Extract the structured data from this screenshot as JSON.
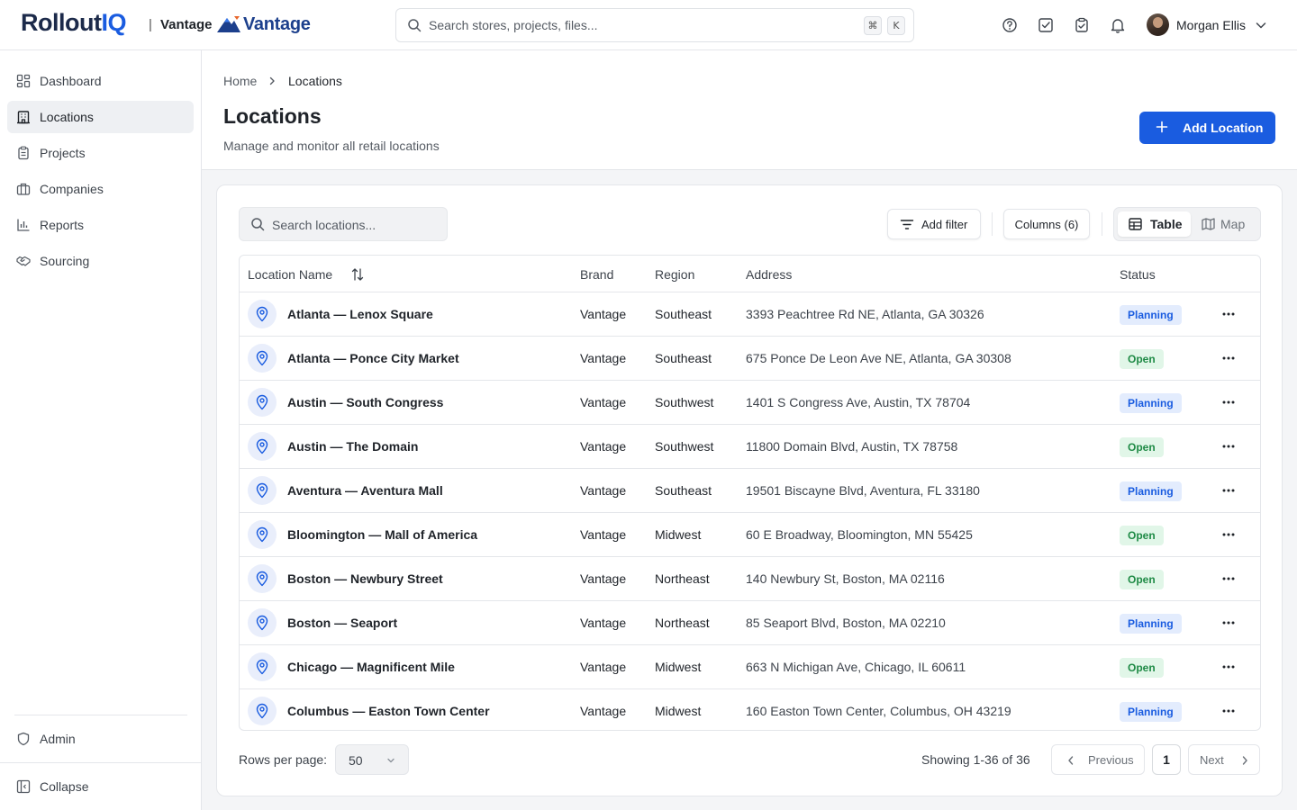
{
  "app": {
    "logo_main": "Rollout",
    "logo_accent": "IQ",
    "separator": "|",
    "tenant": "Vantage",
    "brand_logo_text": "Vantage",
    "accent_color": "#1a5ce0"
  },
  "global_search": {
    "placeholder": "Search stores, projects, files...",
    "shortcut_mod": "⌘",
    "shortcut_key": "K"
  },
  "header_icons": [
    "help-icon",
    "task-check-icon",
    "clipboard-check-icon",
    "bell-icon"
  ],
  "user": {
    "name": "Morgan Ellis"
  },
  "sidebar": {
    "items": [
      {
        "label": "Dashboard",
        "icon": "dashboard-icon"
      },
      {
        "label": "Locations",
        "icon": "building-icon",
        "active": true
      },
      {
        "label": "Projects",
        "icon": "clipboard-icon"
      },
      {
        "label": "Companies",
        "icon": "briefcase-icon"
      },
      {
        "label": "Reports",
        "icon": "bar-chart-icon"
      },
      {
        "label": "Sourcing",
        "icon": "handshake-icon"
      }
    ],
    "admin_label": "Admin",
    "collapse_label": "Collapse"
  },
  "breadcrumb": {
    "home": "Home",
    "current": "Locations"
  },
  "page": {
    "title": "Locations",
    "subtitle": "Manage and monitor all retail locations",
    "add_button": "Add Location"
  },
  "toolbar": {
    "search_placeholder": "Search locations...",
    "filter_label": "Add filter",
    "columns_label": "Columns (6)",
    "view_table": "Table",
    "view_map": "Map"
  },
  "table": {
    "headers": {
      "name": "Location Name",
      "brand": "Brand",
      "region": "Region",
      "address": "Address",
      "status": "Status"
    },
    "rows": [
      {
        "name": "Atlanta — Lenox Square",
        "brand": "Vantage",
        "region": "Southeast",
        "address": "3393 Peachtree Rd NE, Atlanta, GA 30326",
        "status": "Planning"
      },
      {
        "name": "Atlanta — Ponce City Market",
        "brand": "Vantage",
        "region": "Southeast",
        "address": "675 Ponce De Leon Ave NE, Atlanta, GA 30308",
        "status": "Open"
      },
      {
        "name": "Austin — South Congress",
        "brand": "Vantage",
        "region": "Southwest",
        "address": "1401 S Congress Ave, Austin, TX 78704",
        "status": "Planning"
      },
      {
        "name": "Austin — The Domain",
        "brand": "Vantage",
        "region": "Southwest",
        "address": "11800 Domain Blvd, Austin, TX 78758",
        "status": "Open"
      },
      {
        "name": "Aventura — Aventura Mall",
        "brand": "Vantage",
        "region": "Southeast",
        "address": "19501 Biscayne Blvd, Aventura, FL 33180",
        "status": "Planning"
      },
      {
        "name": "Bloomington — Mall of America",
        "brand": "Vantage",
        "region": "Midwest",
        "address": "60 E Broadway, Bloomington, MN 55425",
        "status": "Open"
      },
      {
        "name": "Boston — Newbury Street",
        "brand": "Vantage",
        "region": "Northeast",
        "address": "140 Newbury St, Boston, MA 02116",
        "status": "Open"
      },
      {
        "name": "Boston — Seaport",
        "brand": "Vantage",
        "region": "Northeast",
        "address": "85 Seaport Blvd, Boston, MA 02210",
        "status": "Planning"
      },
      {
        "name": "Chicago — Magnificent Mile",
        "brand": "Vantage",
        "region": "Midwest",
        "address": "663 N Michigan Ave, Chicago, IL 60611",
        "status": "Open"
      },
      {
        "name": "Columbus — Easton Town Center",
        "brand": "Vantage",
        "region": "Midwest",
        "address": "160 Easton Town Center, Columbus, OH 43219",
        "status": "Planning"
      }
    ]
  },
  "pagination": {
    "rows_per_page_label": "Rows per page:",
    "rows_per_page_value": "50",
    "showing": "Showing 1-36 of 36",
    "previous": "Previous",
    "page": "1",
    "next": "Next"
  }
}
